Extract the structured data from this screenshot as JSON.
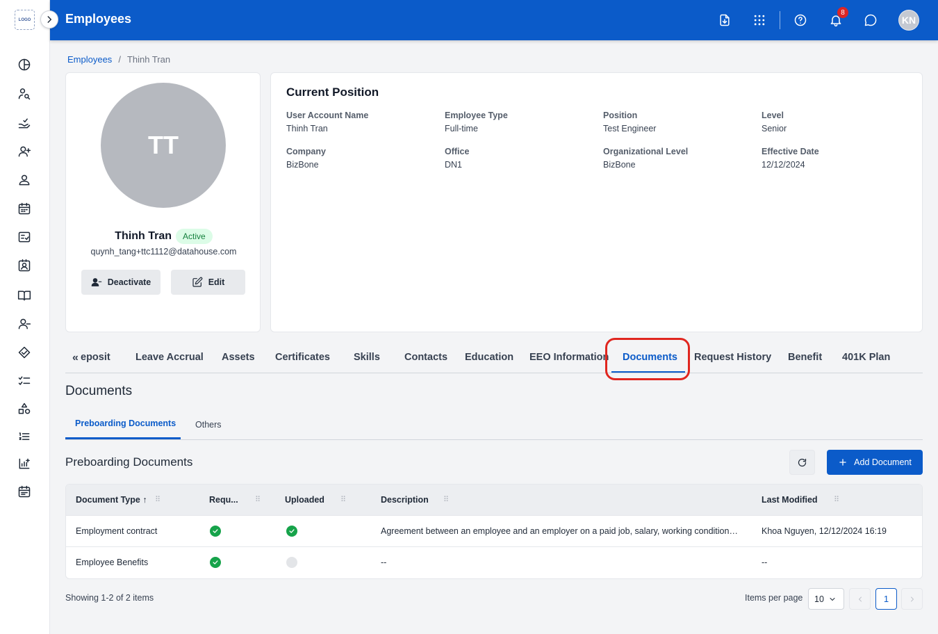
{
  "app": {
    "logo_text": "LOGO",
    "title": "Employees"
  },
  "header": {
    "notification_count": "8",
    "user_initials": "KN"
  },
  "breadcrumb": {
    "root": "Employees",
    "separator": "/",
    "current": "Thinh Tran"
  },
  "profile": {
    "initials": "TT",
    "name": "Thinh Tran",
    "status": "Active",
    "email": "quynh_tang+ttc1112@datahouse.com",
    "deactivate_label": "Deactivate",
    "edit_label": "Edit"
  },
  "current_position": {
    "title": "Current Position",
    "fields": [
      {
        "label": "User Account Name",
        "value": "Thinh Tran"
      },
      {
        "label": "Employee Type",
        "value": "Full-time"
      },
      {
        "label": "Position",
        "value": "Test Engineer"
      },
      {
        "label": "Level",
        "value": "Senior"
      },
      {
        "label": "Company",
        "value": "BizBone"
      },
      {
        "label": "Office",
        "value": "DN1"
      },
      {
        "label": "Organizational Level",
        "value": "BizBone"
      },
      {
        "label": "Effective Date",
        "value": "12/12/2024"
      }
    ]
  },
  "tabs": {
    "scroll_left": "«",
    "items": [
      "eposit",
      "Leave Accrual",
      "Assets",
      "Certificates",
      "Skills",
      "Contacts",
      "Education",
      "EEO Information",
      "Documents",
      "Request History",
      "Benefit",
      "401K Plan"
    ],
    "active": "Documents"
  },
  "documents": {
    "section_title": "Documents",
    "subtabs": [
      "Preboarding Documents",
      "Others"
    ],
    "table_title": "Preboarding Documents",
    "add_label": "Add Document",
    "columns": [
      "Document Type",
      "Requ...",
      "Uploaded",
      "Description",
      "Last Modified"
    ],
    "rows": [
      {
        "type": "Employment contract",
        "required": true,
        "uploaded": true,
        "description": "Agreement between an employee and an employer on a paid job, salary, working conditions,...",
        "last_modified": "Khoa Nguyen, 12/12/2024 16:19"
      },
      {
        "type": "Employee Benefits",
        "required": true,
        "uploaded": false,
        "description": "--",
        "last_modified": "--"
      }
    ]
  },
  "pagination": {
    "showing": "Showing 1-2 of 2 items",
    "items_per_page_label": "Items per page",
    "items_per_page": "10",
    "current_page": "1"
  },
  "colors": {
    "primary": "#0b5bc9",
    "success": "#16a34a",
    "highlight": "#e0261f",
    "badge": "#dc2626"
  }
}
